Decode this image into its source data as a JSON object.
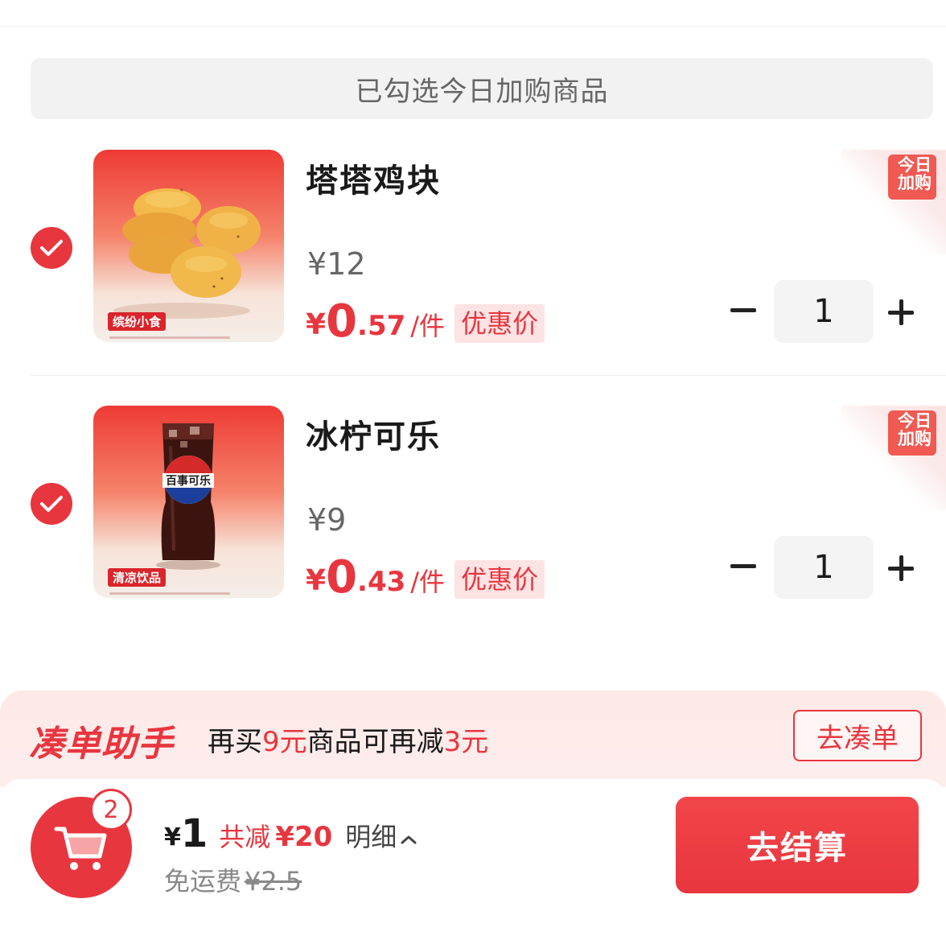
{
  "banner": {
    "text": "已勾选今日加购商品"
  },
  "items": [
    {
      "name": "塔塔鸡块",
      "thumb_tag": "缤纷小食",
      "orig_price": "¥12",
      "deal_yen": "¥",
      "deal_int": "0",
      "deal_dec": ".57",
      "deal_unit": "/件",
      "deal_badge": "优惠价",
      "corner_badge": "今日加购",
      "quantity": "1",
      "checked": true
    },
    {
      "name": "冰柠可乐",
      "thumb_tag": "清凉饮品",
      "product_label": "百事可乐",
      "orig_price": "¥9",
      "deal_yen": "¥",
      "deal_int": "0",
      "deal_dec": ".43",
      "deal_unit": "/件",
      "deal_badge": "优惠价",
      "corner_badge": "今日加购",
      "quantity": "1",
      "checked": true
    }
  ],
  "helper": {
    "title": "凑单助手",
    "text_a": "再买",
    "text_hl1": "9元",
    "text_b": "商品可再减",
    "text_hl2": "3元",
    "button": "去凑单"
  },
  "bottom": {
    "cart_count": "2",
    "total_yen": "¥",
    "total_val": "1",
    "saved_label": "共减",
    "saved_val": "¥20",
    "detail_label": "明细",
    "shipping_label": "免运费",
    "shipping_orig": "¥2.5",
    "checkout": "去结算"
  },
  "colors": {
    "accent": "#e8363f",
    "helper_bg": "#fde9e7"
  }
}
